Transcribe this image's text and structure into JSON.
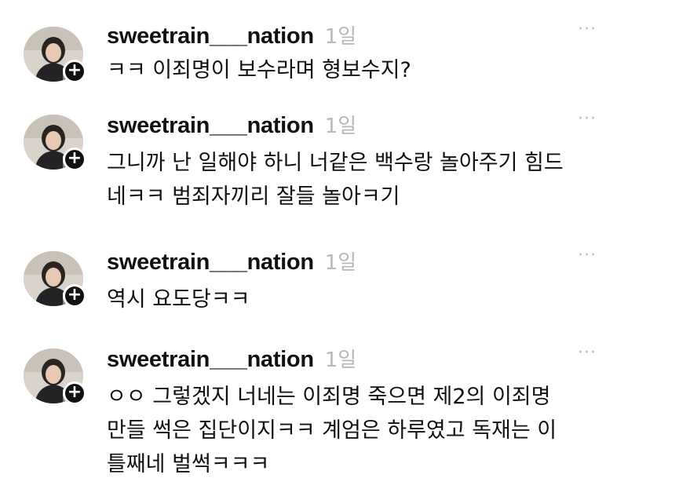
{
  "comments": [
    {
      "username": "sweetrain___nation",
      "time": "1일",
      "more": "···",
      "add": "+",
      "lines": [
        "ㅋㅋ 이죄명이 보수라며 형보수지?"
      ]
    },
    {
      "username": "sweetrain___nation",
      "time": "1일",
      "more": "···",
      "add": "+",
      "lines": [
        "그니까 난 일해야 하니 너같은 백수랑 놀아주기 힘드",
        "네ㅋㅋ 범죄자끼리 잘들 놀아ㅋ기"
      ]
    },
    {
      "username": "sweetrain___nation",
      "time": "1일",
      "more": "···",
      "add": "+",
      "lines": [
        "역시 요도당ㅋㅋ"
      ]
    },
    {
      "username": "sweetrain___nation",
      "time": "1일",
      "more": "···",
      "add": "+",
      "lines": [
        "ㅇㅇ 그렇겠지 너네는 이죄명 죽으면 제2의 이죄명",
        "만들 썩은 집단이지ㅋㅋ 계엄은 하루였고 독재는 이",
        "틀째네 벌썩ㅋㅋㅋ"
      ]
    }
  ],
  "colors": {
    "text": "#111111",
    "muted": "#b8b8b8",
    "badge": "#111111",
    "background": "#ffffff"
  },
  "icons": {
    "avatar": "profile-photo",
    "add": "plus-icon",
    "more": "more-horizontal-icon"
  }
}
